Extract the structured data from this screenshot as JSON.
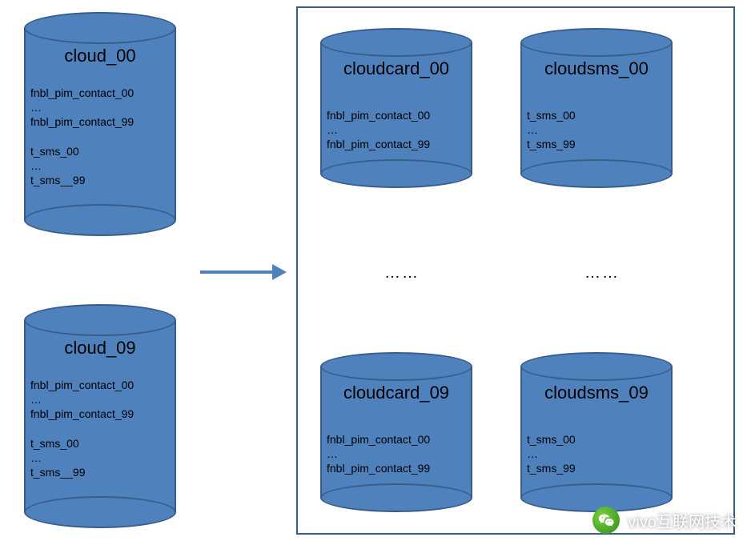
{
  "left": {
    "top": {
      "title": "cloud_00",
      "lines": "fnbl_pim_contact_00\n…\nfnbl_pim_contact_99\n\nt_sms_00\n…\nt_sms__99"
    },
    "bottom": {
      "title": "cloud_09",
      "lines": "fnbl_pim_contact_00\n…\nfnbl_pim_contact_99\n\nt_sms_00\n…\nt_sms__99"
    }
  },
  "right": {
    "card_top": {
      "title": "cloudcard_00",
      "lines": "fnbl_pim_contact_00\n…\nfnbl_pim_contact_99"
    },
    "sms_top": {
      "title": "cloudsms_00",
      "lines": "t_sms_00\n…\nt_sms_99"
    },
    "card_bottom": {
      "title": "cloudcard_09",
      "lines": "fnbl_pim_contact_00\n…\nfnbl_pim_contact_99"
    },
    "sms_bottom": {
      "title": "cloudsms_09",
      "lines": "t_sms_00\n…\nt_sms_99"
    },
    "ellipsis": "……"
  },
  "watermark": "vivo互联网技术"
}
